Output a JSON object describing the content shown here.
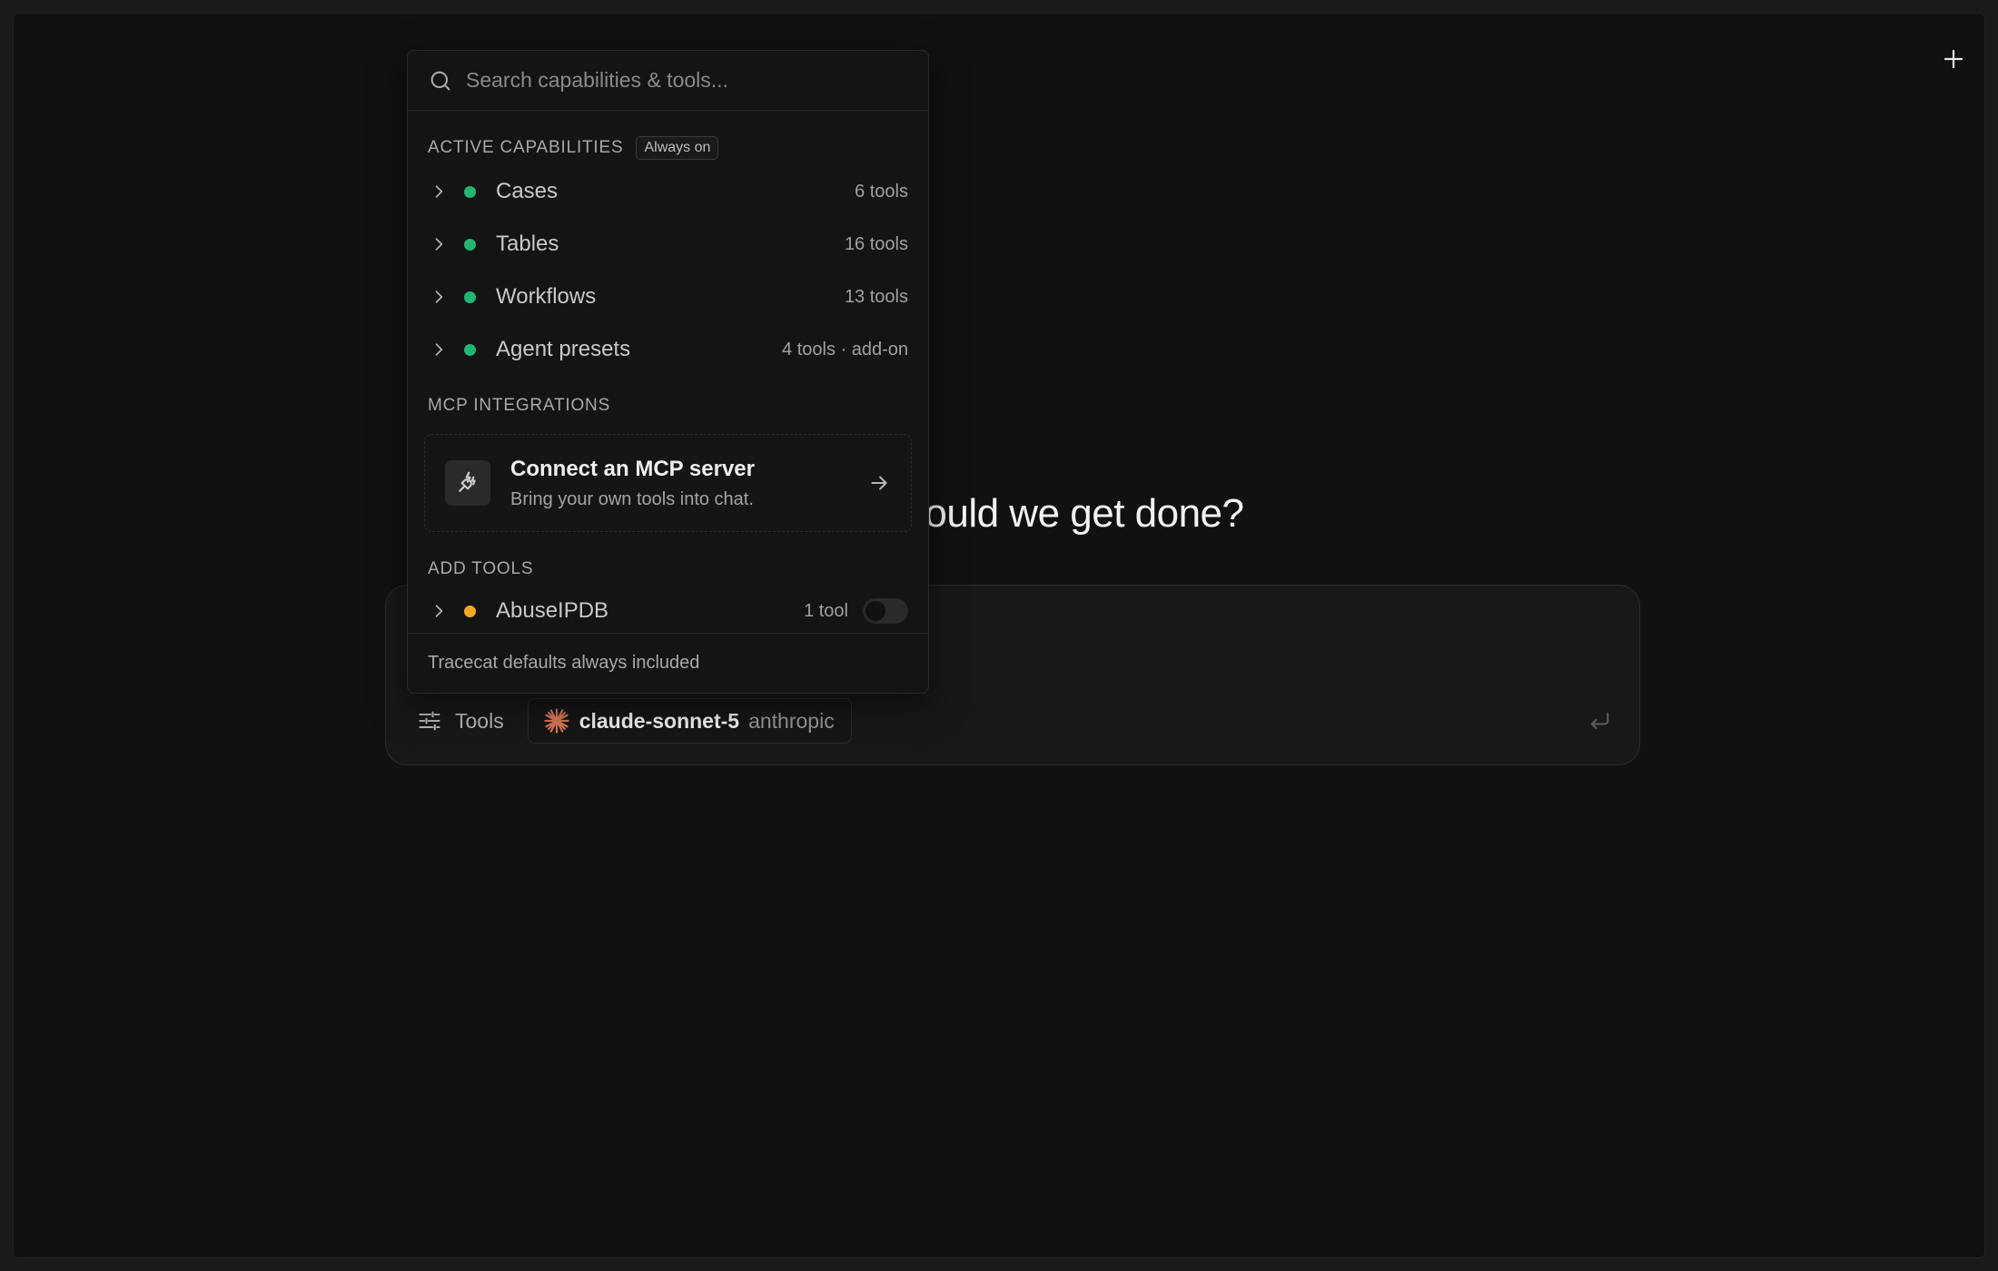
{
  "header": {
    "new_chat_icon": "plus-icon"
  },
  "main": {
    "headline": "What should we get done?"
  },
  "composer": {
    "input_placeholder": "",
    "tools_label": "Tools",
    "tools_icon": "sliders-icon",
    "model": {
      "name": "claude-sonnet-5",
      "provider": "anthropic",
      "icon": "anthropic-logo-icon",
      "icon_color": "#d97757"
    },
    "send_icon": "enter-return-icon"
  },
  "popover": {
    "search": {
      "placeholder": "Search capabilities & tools...",
      "value": ""
    },
    "active": {
      "title": "ACTIVE CAPABILITIES",
      "badge": "Always on",
      "items": [
        {
          "label": "Cases",
          "count": "6 tools",
          "status_color": "#22b573"
        },
        {
          "label": "Tables",
          "count": "16 tools",
          "status_color": "#22b573"
        },
        {
          "label": "Workflows",
          "count": "13 tools",
          "status_color": "#22b573"
        },
        {
          "label": "Agent presets",
          "count": "4 tools · add-on",
          "status_color": "#22b573"
        }
      ]
    },
    "mcp": {
      "title": "MCP INTEGRATIONS",
      "card_title": "Connect an MCP server",
      "card_subtitle": "Bring your own tools into chat.",
      "icon": "plug-icon"
    },
    "add_tools": {
      "title": "ADD TOOLS",
      "items": [
        {
          "label": "AbuseIPDB",
          "count": "1 tool",
          "status_color": "#f5a623",
          "enabled": false
        }
      ]
    },
    "footer": "Tracecat defaults always included"
  }
}
